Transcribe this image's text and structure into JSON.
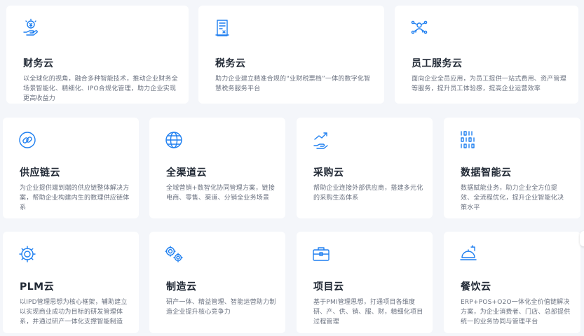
{
  "accent_color": "#1e7ff0",
  "cards": [
    {
      "name": "finance-cloud",
      "icon": "hand-coin-icon",
      "title": "财务云",
      "desc": "以全球化的视角，融合多种智能技术，推动企业财务全场景智能化、精细化、IPO合规化管理，助力企业实现更高收益力"
    },
    {
      "name": "tax-cloud",
      "icon": "tax-document-icon",
      "title": "税务云",
      "desc": "助力企业建立精准合规的“业财税票档”一体的数字化智慧税务服务平台"
    },
    {
      "name": "hr-service-cloud",
      "icon": "people-network-icon",
      "title": "员工服务云",
      "desc": "面向企业全员应用，为员工提供一站式费用、资产管理等服务，提升员工体验感，提高企业运营效率"
    },
    {
      "name": "supply-chain-cloud",
      "icon": "chain-link-icon",
      "title": "供应链云",
      "desc": "为企业提供端到端的供应链整体解决方案，帮助企业构建内生的数理供应链体系"
    },
    {
      "name": "omnichannel-cloud",
      "icon": "globe-icon",
      "title": "全渠道云",
      "desc": "全域营销+数智化协同管理方案，链接电商、零售、渠道、分销全业务场景"
    },
    {
      "name": "procurement-cloud",
      "icon": "growth-hand-icon",
      "title": "采购云",
      "desc": "帮助企业连接外部供应商，搭建多元化的采购生态体系"
    },
    {
      "name": "data-intelligence-cloud",
      "icon": "binary-data-icon",
      "title": "数据智能云",
      "desc": "数据赋能业务，助力企业全方位提效、全流程优化，提升企业智能化决策水平"
    },
    {
      "name": "plm-cloud",
      "icon": "stacked-gear-icon",
      "title": "PLM云",
      "desc": "以IPD管理思想为核心框架，辅助建立以实现商业成功为目标的研发管理体系，并通过研产一体化支撑智能制造"
    },
    {
      "name": "manufacturing-cloud",
      "icon": "gears-icon",
      "title": "制造云",
      "desc": "研产一体、精益管理、智能运营助力制造企业提升核心竞争力"
    },
    {
      "name": "project-cloud",
      "icon": "briefcase-icon",
      "title": "项目云",
      "desc": "基于PMI管理思想，打通项目各维度研、产、供、销、服、财，精细化项目过程管理"
    },
    {
      "name": "catering-cloud",
      "icon": "food-cloche-icon",
      "title": "餐饮云",
      "desc": "ERP+POS+O2O一体化全价值链解决方案，为企业消费者、门店、总部提供统一的业务协同与管理平台"
    }
  ]
}
